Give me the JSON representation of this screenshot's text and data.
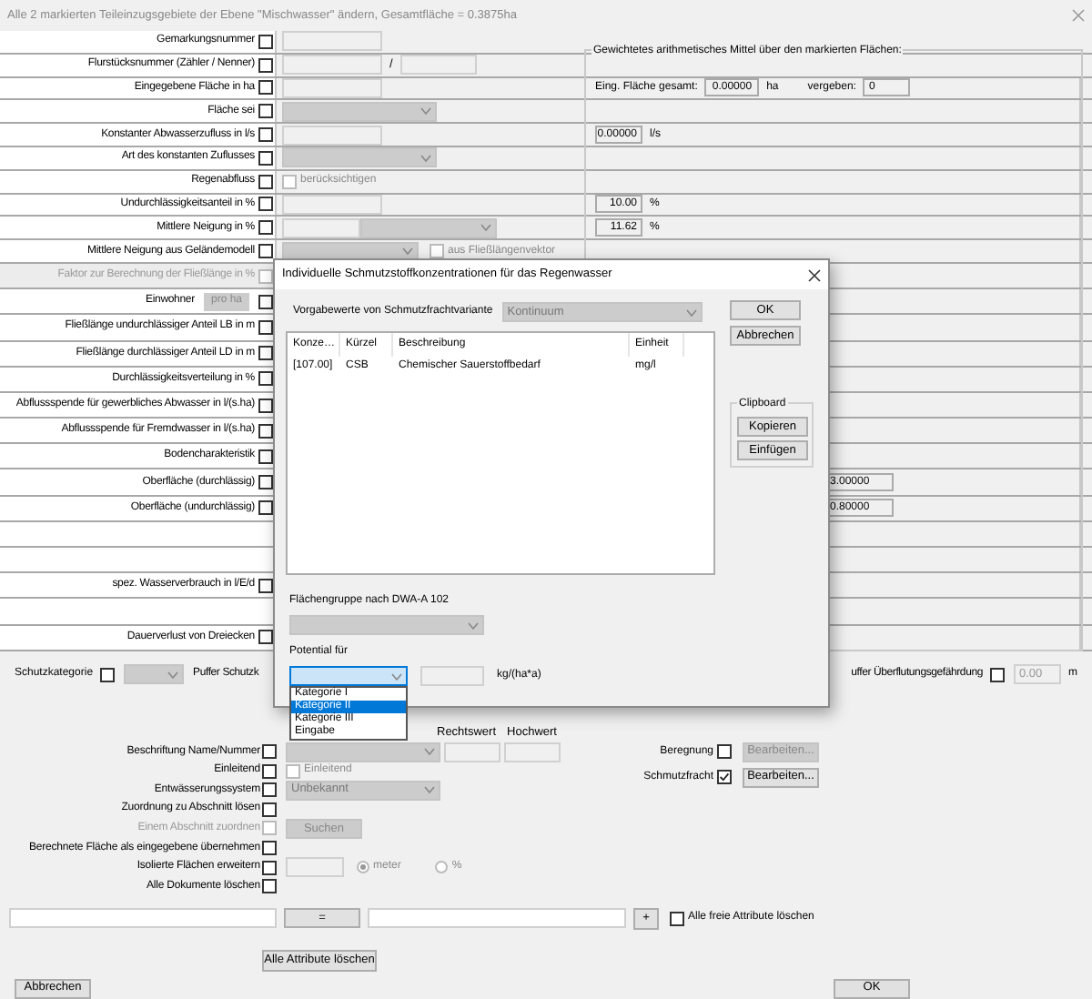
{
  "window": {
    "title": "Alle 2 markierten Teileinzugsgebiete der Ebene \"Mischwasser\" ändern, Gesamtfläche = 0.3875ha"
  },
  "group_title": "Gewichtetes arithmetisches Mittel über den markierten Flächen:",
  "rows": [
    {
      "label": "Gemarkungsnummer",
      "checked": false,
      "kind": "field"
    },
    {
      "label": "Flurstücksnummer (Zähler / Nenner)",
      "checked": false,
      "kind": "pair",
      "separator": "/"
    },
    {
      "label": "Eingegebene Fläche in ha",
      "checked": false,
      "kind": "field",
      "right": {
        "kind": "total",
        "label": "Eing. Fläche gesamt:",
        "value": "0.00000",
        "unit": "ha",
        "label2": "vergeben:",
        "value2": "0"
      }
    },
    {
      "label": "Fläche sei",
      "checked": false,
      "kind": "dropdown"
    },
    {
      "label": "Konstanter Abwasserzufluss in l/s",
      "checked": false,
      "kind": "field",
      "right": {
        "kind": "value",
        "value": "0.00000",
        "unit": "l/s"
      }
    },
    {
      "label": "Art des konstanten Zuflusses",
      "checked": false,
      "kind": "dropdown"
    },
    {
      "label": "Regenabfluss",
      "checked": false,
      "kind": "option",
      "option": {
        "label": "berücksichtigen",
        "checked": false
      }
    },
    {
      "label": "Undurchlässigkeitsanteil in %",
      "checked": false,
      "kind": "field",
      "right": {
        "kind": "value",
        "value": "10.00",
        "unit": "%"
      }
    },
    {
      "label": "Mittlere Neigung in %",
      "checked": false,
      "kind": "field_dropdown",
      "right": {
        "kind": "value",
        "value": "11.62",
        "unit": "%"
      }
    },
    {
      "label": "Mittlere Neigung aus Geländemodell",
      "checked": false,
      "kind": "dropdown_option",
      "option": {
        "label": "aus Fließlängenvektor",
        "checked": false
      }
    },
    {
      "label": "Faktor zur Berechnung der Fließlänge in %",
      "checked": false,
      "disabled": true,
      "kind": "none"
    },
    {
      "label": "Einwohner",
      "checked": false,
      "kind": "none",
      "button": "pro ha"
    },
    {
      "label": "Fließlänge undurchlässiger Anteil LB in m",
      "checked": false,
      "kind": "none"
    },
    {
      "label": "Fließlänge durchlässiger Anteil LD in m",
      "checked": false,
      "kind": "none"
    },
    {
      "label": "Durchlässigkeitsverteilung in %",
      "checked": false,
      "kind": "none"
    },
    {
      "label": "Abflussspende für gewerbliches Abwasser in l/(s.ha)",
      "checked": false,
      "kind": "none"
    },
    {
      "label": "Abflussspende für Fremdwasser in l/(s.ha)",
      "checked": false,
      "kind": "none"
    },
    {
      "label": "Bodencharakteristik",
      "checked": false,
      "kind": "none"
    },
    {
      "label": "Oberfläche (durchlässig)",
      "checked": false,
      "kind": "none",
      "right": {
        "kind": "value_far",
        "value": "3.00000"
      }
    },
    {
      "label": "Oberfläche (undurchlässig)",
      "checked": false,
      "kind": "none",
      "right": {
        "kind": "value_far",
        "value": "0.80000"
      }
    },
    {
      "kind": "none"
    },
    {
      "kind": "none"
    },
    {
      "label": "spez. Wasserverbrauch in l/E/d",
      "checked": false,
      "kind": "none"
    },
    {
      "kind": "none"
    },
    {
      "label": "Dauerverlust von Dreiecken",
      "checked": false,
      "kind": "none"
    }
  ],
  "protection": {
    "label": "Schutzkategorie",
    "checked": false,
    "buffer_label": "Puffer Schutzk",
    "flood_label": "uffer Überflutungsgefährdung",
    "flood_checked": false,
    "flood_value": "0.00",
    "flood_unit": "m"
  },
  "coords_header": [
    "Rechtswert",
    "Hochwert"
  ],
  "options": [
    {
      "label": "Beschriftung Name/Nummer",
      "checked": false,
      "kind": "dropdown_coords"
    },
    {
      "label": "Einleitend",
      "checked": false,
      "kind": "option",
      "option": {
        "label": "Einleitend",
        "checked": false
      }
    },
    {
      "label": "Entwässerungssystem",
      "checked": false,
      "kind": "dropdown",
      "value": "Unbekannt"
    },
    {
      "label": "Zuordnung zu Abschnitt lösen",
      "checked": false,
      "kind": "plain"
    },
    {
      "label": "Einem Abschnitt zuordnen",
      "checked": false,
      "disabled": true,
      "kind": "button",
      "button": "Suchen"
    },
    {
      "label": "Berechnete Fläche als eingegebene übernehmen",
      "checked": false,
      "kind": "plain"
    },
    {
      "label": "Isolierte Flächen erweitern",
      "checked": false,
      "kind": "radios",
      "radios": [
        {
          "label": "meter",
          "selected": true
        },
        {
          "label": "%",
          "selected": false
        }
      ]
    },
    {
      "label": "Alle Dokumente löschen",
      "checked": false,
      "kind": "plain"
    }
  ],
  "side_options": [
    {
      "label": "Beregnung",
      "checked": false,
      "button": "Bearbeiten...",
      "disabled": true
    },
    {
      "label": "Schmutzfracht",
      "checked": true,
      "button": "Bearbeiten...",
      "disabled": false
    }
  ],
  "formula": {
    "equals": "=",
    "plus": "+",
    "clear_free": "Alle freie Attribute löschen",
    "clear_free_checked": false
  },
  "clear_all": "Alle Attribute löschen",
  "cancel": "Abbrechen",
  "ok": "OK",
  "dialog": {
    "title": "Individuelle Schmutzstoffkonzentrationen für das Regenwasser",
    "variant_label": "Vorgabewerte von Schmutzfrachtvariante",
    "variant_value": "Kontinuum",
    "ok": "OK",
    "cancel": "Abbrechen",
    "columns": [
      "Konze…",
      "Kürzel",
      "Beschreibung",
      "Einheit"
    ],
    "rows": [
      [
        "[107.00]",
        "CSB",
        "Chemischer Sauerstoffbedarf",
        "mg/l"
      ]
    ],
    "clipboard": {
      "title": "Clipboard",
      "copy": "Kopieren",
      "paste": "Einfügen"
    },
    "group_label": "Flächengruppe nach DWA-A 102",
    "potential_label": "Potential für",
    "unit": "kg/(ha*a)",
    "open": true,
    "potential_options": [
      {
        "label": "Kategorie I",
        "selected": false
      },
      {
        "label": "Kategorie II",
        "selected": true
      },
      {
        "label": "Kategorie III",
        "selected": false
      },
      {
        "label": "Eingabe",
        "selected": false
      }
    ]
  }
}
